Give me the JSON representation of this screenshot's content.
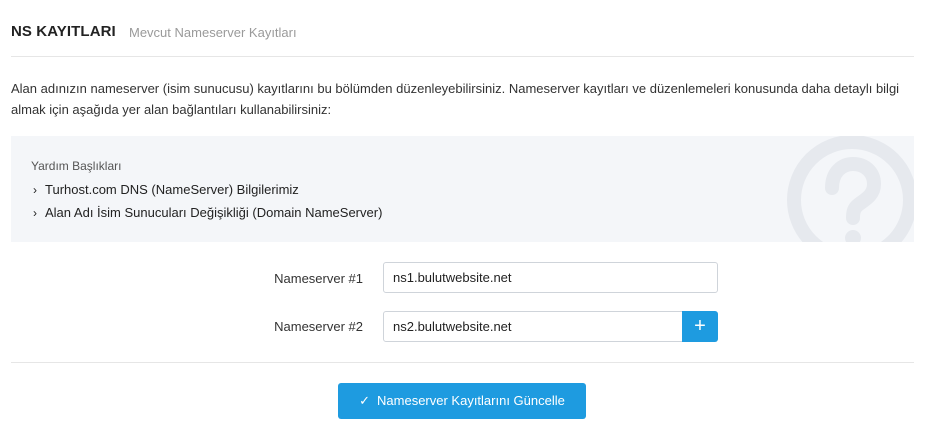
{
  "header": {
    "title": "NS KAYITLARI",
    "subtitle": "Mevcut Nameserver Kayıtları"
  },
  "description": "Alan adınızın nameserver (isim sunucusu) kayıtlarını bu bölümden düzenleyebilirsiniz. Nameserver kayıtları ve düzenlemeleri konusunda daha detaylı bilgi almak için aşağıda yer alan bağlantıları kullanabilirsiniz:",
  "help": {
    "title": "Yardım Başlıkları",
    "links": [
      {
        "label": "Turhost.com DNS (NameServer) Bilgilerimiz"
      },
      {
        "label": "Alan Adı İsim Sunucuları Değişikliği (Domain NameServer)"
      }
    ],
    "watermark_icon": "question-circle-icon"
  },
  "form": {
    "nameservers": [
      {
        "label": "Nameserver #1",
        "value": "ns1.bulutwebsite.net"
      },
      {
        "label": "Nameserver #2",
        "value": "ns2.bulutwebsite.net"
      }
    ],
    "add_button_icon": "plus-icon",
    "submit_label": "Nameserver Kayıtlarını Güncelle",
    "submit_icon": "check-icon"
  },
  "colors": {
    "accent": "#1e9be0",
    "help_background": "#f4f6f9"
  }
}
